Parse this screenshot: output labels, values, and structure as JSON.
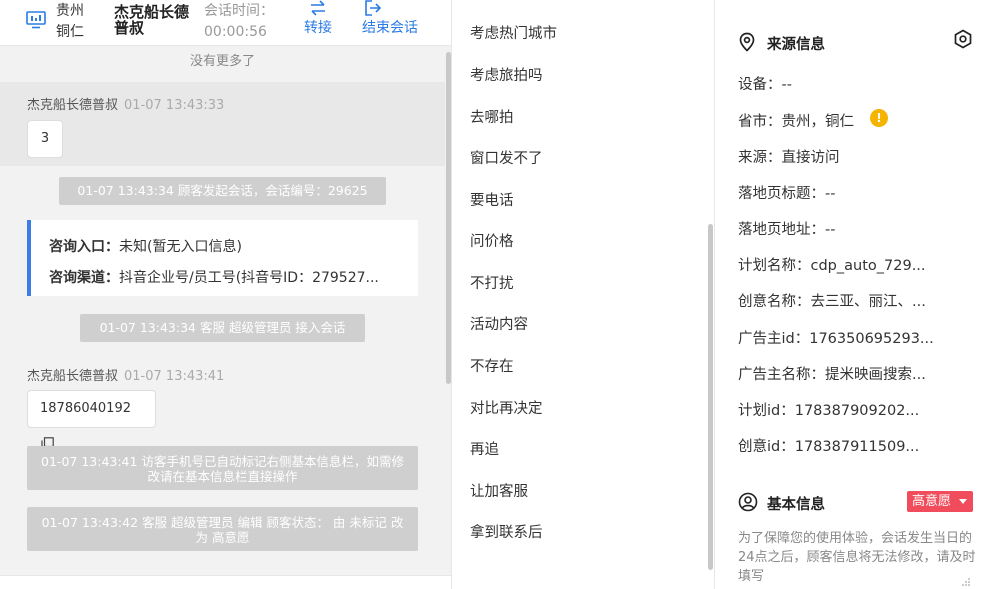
{
  "header": {
    "location": "贵州 铜仁",
    "visitor_name": "杰克船长德普叔",
    "session_time_label": "会话时间：",
    "session_time_value": "00:00:56",
    "transfer_label": "转接",
    "end_label": "结束会话"
  },
  "chat": {
    "no_more": "没有更多了",
    "messages": [
      {
        "sender": "杰克船长德普叔",
        "time": "01-07 13:43:33",
        "text": "3"
      },
      {
        "system": "01-07 13:43:34 顾客发起会话，会话编号：29625"
      },
      {
        "consult_entry_label": "咨询入口：",
        "consult_entry_value": "未知(暂无入口信息)",
        "consult_channel_label": "咨询渠道：",
        "consult_channel_value": "抖音企业号/员工号(抖音号ID：279527..."
      },
      {
        "system": "01-07 13:43:34 客服 超级管理员 接入会话"
      },
      {
        "sender": "杰克船长德普叔",
        "time": "01-07 13:43:41",
        "text": "18786040192"
      },
      {
        "system": "01-07 13:43:41 访客手机号已自动标记右侧基本信息栏，如需修改请在基本信息栏直接操作"
      },
      {
        "system": "01-07 13:43:42 客服 超级管理员 编辑 顾客状态： 由 未标记 改为 高意愿"
      }
    ]
  },
  "quick_replies": [
    "考虑热门城市",
    "考虑旅拍吗",
    "去哪拍",
    "窗口发不了",
    "要电话",
    "问价格",
    "不打扰",
    "活动内容",
    "不存在",
    "对比再决定",
    "再追",
    "让加客服",
    "拿到联系后"
  ],
  "source_info": {
    "title": "来源信息",
    "fields": [
      "设备：--",
      "省市：贵州，铜仁",
      "来源：直接访问",
      "落地页标题：--",
      "落地页地址：--",
      "计划名称：cdp_auto_729...",
      "创意名称：去三亚、丽江、...",
      "广告主id：176350695293...",
      "广告主名称：提米映画搜索...",
      "计划id：178387909202...",
      "创意id：178387911509..."
    ],
    "warn_glyph": "!"
  },
  "basic_info": {
    "title": "基本信息",
    "intent_badge": "高意愿",
    "notice": "为了保障您的使用体验，会话发生当日的24点之后，顾客信息将无法修改，请及时填写"
  },
  "colors": {
    "accent": "#2a7be4",
    "badge": "#f04c5c",
    "warn": "#f4b400",
    "system_msg": "#cfcfcf"
  }
}
